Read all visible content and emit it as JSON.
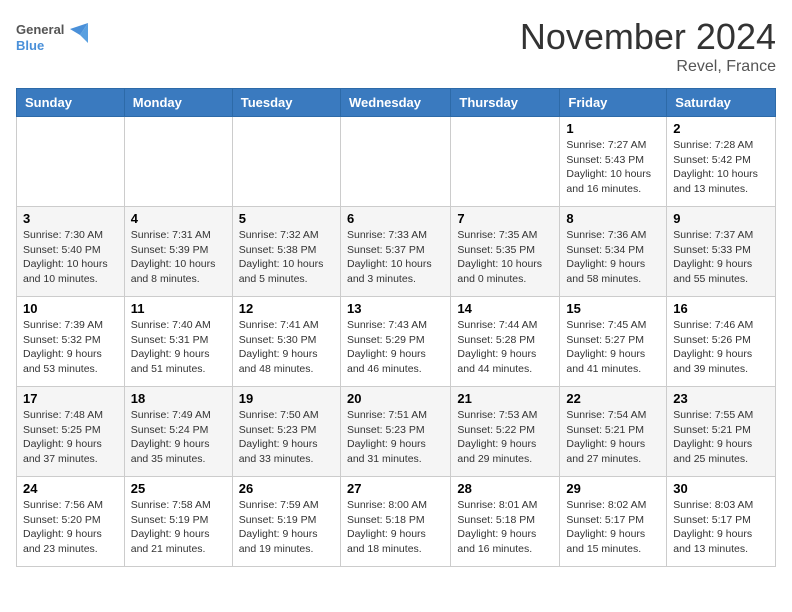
{
  "header": {
    "logo_general": "General",
    "logo_blue": "Blue",
    "month_title": "November 2024",
    "location": "Revel, France"
  },
  "days_of_week": [
    "Sunday",
    "Monday",
    "Tuesday",
    "Wednesday",
    "Thursday",
    "Friday",
    "Saturday"
  ],
  "weeks": [
    [
      {
        "day": "",
        "info": ""
      },
      {
        "day": "",
        "info": ""
      },
      {
        "day": "",
        "info": ""
      },
      {
        "day": "",
        "info": ""
      },
      {
        "day": "",
        "info": ""
      },
      {
        "day": "1",
        "info": "Sunrise: 7:27 AM\nSunset: 5:43 PM\nDaylight: 10 hours and 16 minutes."
      },
      {
        "day": "2",
        "info": "Sunrise: 7:28 AM\nSunset: 5:42 PM\nDaylight: 10 hours and 13 minutes."
      }
    ],
    [
      {
        "day": "3",
        "info": "Sunrise: 7:30 AM\nSunset: 5:40 PM\nDaylight: 10 hours and 10 minutes."
      },
      {
        "day": "4",
        "info": "Sunrise: 7:31 AM\nSunset: 5:39 PM\nDaylight: 10 hours and 8 minutes."
      },
      {
        "day": "5",
        "info": "Sunrise: 7:32 AM\nSunset: 5:38 PM\nDaylight: 10 hours and 5 minutes."
      },
      {
        "day": "6",
        "info": "Sunrise: 7:33 AM\nSunset: 5:37 PM\nDaylight: 10 hours and 3 minutes."
      },
      {
        "day": "7",
        "info": "Sunrise: 7:35 AM\nSunset: 5:35 PM\nDaylight: 10 hours and 0 minutes."
      },
      {
        "day": "8",
        "info": "Sunrise: 7:36 AM\nSunset: 5:34 PM\nDaylight: 9 hours and 58 minutes."
      },
      {
        "day": "9",
        "info": "Sunrise: 7:37 AM\nSunset: 5:33 PM\nDaylight: 9 hours and 55 minutes."
      }
    ],
    [
      {
        "day": "10",
        "info": "Sunrise: 7:39 AM\nSunset: 5:32 PM\nDaylight: 9 hours and 53 minutes."
      },
      {
        "day": "11",
        "info": "Sunrise: 7:40 AM\nSunset: 5:31 PM\nDaylight: 9 hours and 51 minutes."
      },
      {
        "day": "12",
        "info": "Sunrise: 7:41 AM\nSunset: 5:30 PM\nDaylight: 9 hours and 48 minutes."
      },
      {
        "day": "13",
        "info": "Sunrise: 7:43 AM\nSunset: 5:29 PM\nDaylight: 9 hours and 46 minutes."
      },
      {
        "day": "14",
        "info": "Sunrise: 7:44 AM\nSunset: 5:28 PM\nDaylight: 9 hours and 44 minutes."
      },
      {
        "day": "15",
        "info": "Sunrise: 7:45 AM\nSunset: 5:27 PM\nDaylight: 9 hours and 41 minutes."
      },
      {
        "day": "16",
        "info": "Sunrise: 7:46 AM\nSunset: 5:26 PM\nDaylight: 9 hours and 39 minutes."
      }
    ],
    [
      {
        "day": "17",
        "info": "Sunrise: 7:48 AM\nSunset: 5:25 PM\nDaylight: 9 hours and 37 minutes."
      },
      {
        "day": "18",
        "info": "Sunrise: 7:49 AM\nSunset: 5:24 PM\nDaylight: 9 hours and 35 minutes."
      },
      {
        "day": "19",
        "info": "Sunrise: 7:50 AM\nSunset: 5:23 PM\nDaylight: 9 hours and 33 minutes."
      },
      {
        "day": "20",
        "info": "Sunrise: 7:51 AM\nSunset: 5:23 PM\nDaylight: 9 hours and 31 minutes."
      },
      {
        "day": "21",
        "info": "Sunrise: 7:53 AM\nSunset: 5:22 PM\nDaylight: 9 hours and 29 minutes."
      },
      {
        "day": "22",
        "info": "Sunrise: 7:54 AM\nSunset: 5:21 PM\nDaylight: 9 hours and 27 minutes."
      },
      {
        "day": "23",
        "info": "Sunrise: 7:55 AM\nSunset: 5:21 PM\nDaylight: 9 hours and 25 minutes."
      }
    ],
    [
      {
        "day": "24",
        "info": "Sunrise: 7:56 AM\nSunset: 5:20 PM\nDaylight: 9 hours and 23 minutes."
      },
      {
        "day": "25",
        "info": "Sunrise: 7:58 AM\nSunset: 5:19 PM\nDaylight: 9 hours and 21 minutes."
      },
      {
        "day": "26",
        "info": "Sunrise: 7:59 AM\nSunset: 5:19 PM\nDaylight: 9 hours and 19 minutes."
      },
      {
        "day": "27",
        "info": "Sunrise: 8:00 AM\nSunset: 5:18 PM\nDaylight: 9 hours and 18 minutes."
      },
      {
        "day": "28",
        "info": "Sunrise: 8:01 AM\nSunset: 5:18 PM\nDaylight: 9 hours and 16 minutes."
      },
      {
        "day": "29",
        "info": "Sunrise: 8:02 AM\nSunset: 5:17 PM\nDaylight: 9 hours and 15 minutes."
      },
      {
        "day": "30",
        "info": "Sunrise: 8:03 AM\nSunset: 5:17 PM\nDaylight: 9 hours and 13 minutes."
      }
    ]
  ]
}
